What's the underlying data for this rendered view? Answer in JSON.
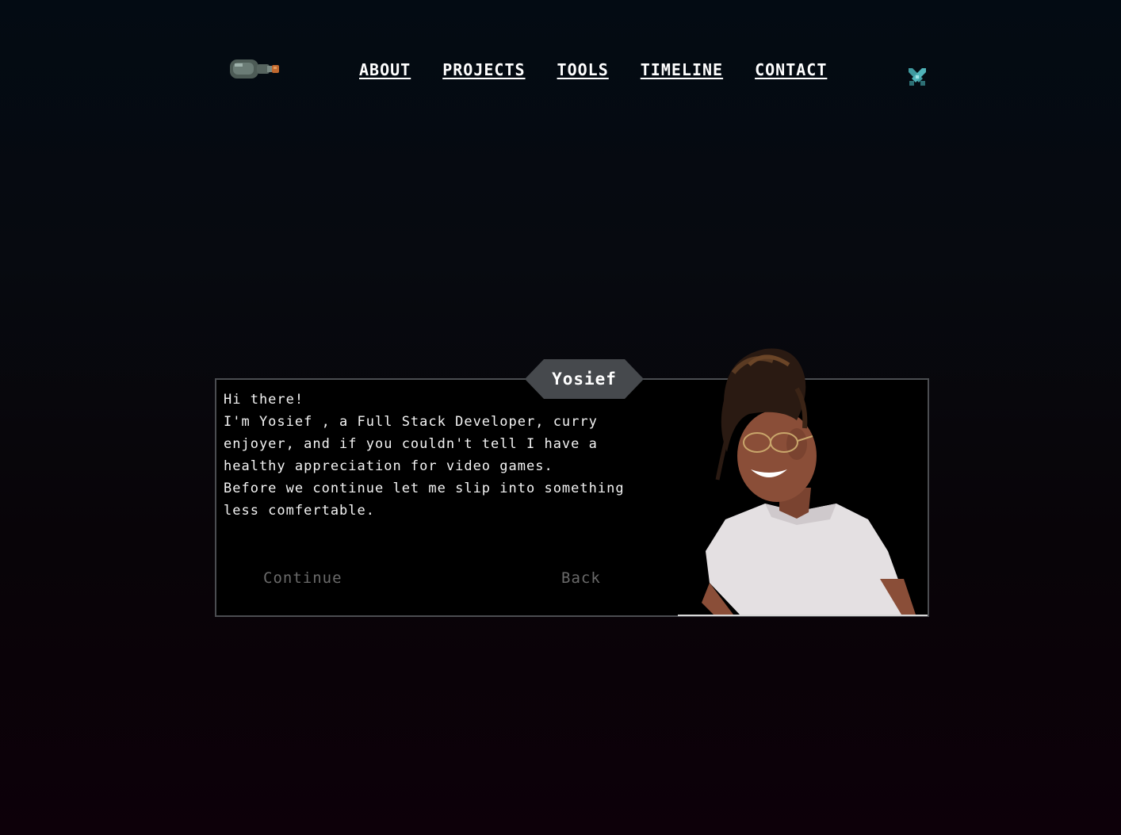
{
  "header": {
    "logo_icon": "bottle-icon",
    "nav": [
      "ABOUT",
      "PROJECTS",
      "TOOLS",
      "TIMELINE",
      "CONTACT"
    ],
    "action_icon": "sword-icon"
  },
  "dialog": {
    "speaker": "Yosief",
    "lines": [
      "Hi there!",
      "I'm Yosief , a Full Stack Developer, curry enjoyer, and if you couldn't tell I have a healthy appreciation for video games.",
      "Before we continue let me slip into something less comfertable."
    ],
    "continue_label": "Continue",
    "back_label": "Back",
    "portrait": "person-portrait"
  },
  "colors": {
    "background_top": "#030b13",
    "background_bottom": "#0d0009",
    "dialog_border": "#4b4d51",
    "nameplate": "#46494d",
    "button_text": "#6a6a6a",
    "sword_accent": "#4fb3b9"
  }
}
